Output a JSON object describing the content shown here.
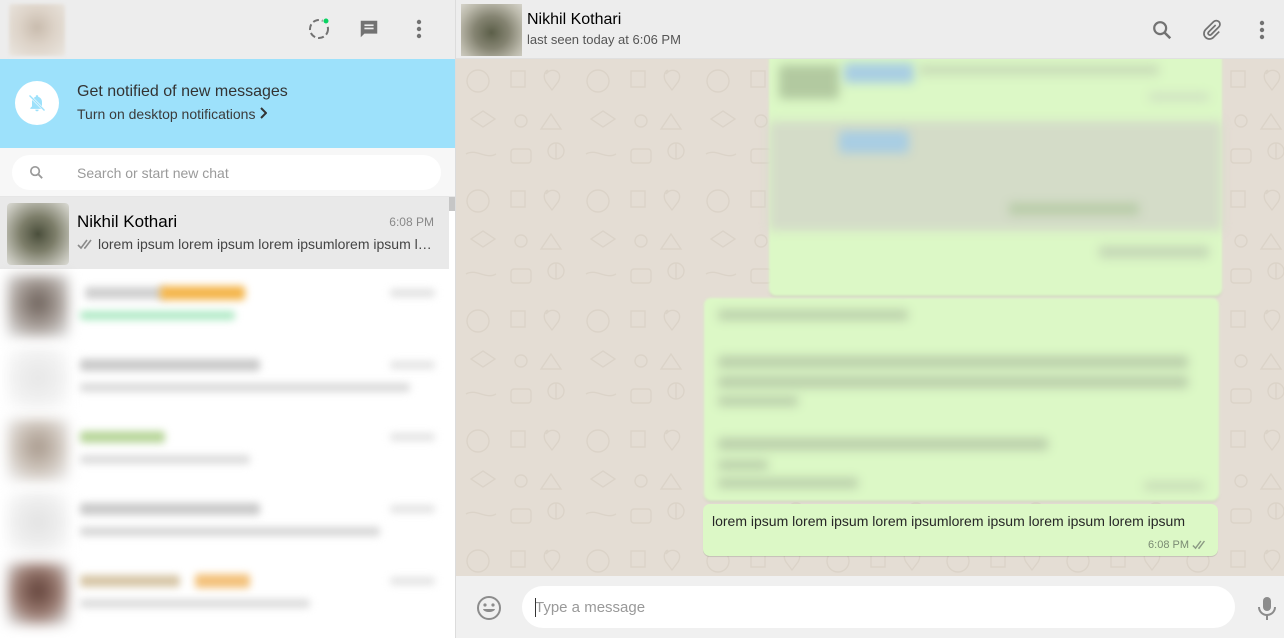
{
  "left_header": {
    "icons": [
      "status-icon",
      "new-chat-icon",
      "menu-icon"
    ],
    "status_dot_color": "#09d261"
  },
  "notification": {
    "title": "Get notified of new messages",
    "link": "Turn on desktop notifications",
    "background": "#9de1fb"
  },
  "search": {
    "placeholder": "Search or start new chat"
  },
  "chats": [
    {
      "name": "Nikhil Kothari",
      "time": "6:08 PM",
      "preview": "lorem ipsum lorem ipsum lorem ipsumlorem ipsum lorem ipsum lorem ipsum",
      "ticks": "double-check-icon",
      "active": true
    }
  ],
  "contact": {
    "name": "Nikhil Kothari",
    "status": "last seen today at 6:06 PM"
  },
  "right_header": {
    "icons": [
      "search-icon",
      "attach-icon",
      "menu-icon"
    ]
  },
  "messages": [
    {
      "text": "lorem ipsum lorem ipsum lorem ipsumlorem ipsum lorem ipsum lorem ipsum",
      "time": "6:08 PM",
      "ticks": "double-check-icon"
    }
  ],
  "compose": {
    "placeholder": "Type a message"
  },
  "colors": {
    "outgoing_bubble": "#dcf8c6",
    "chat_background": "#e4ddd4",
    "header": "#ededed"
  }
}
